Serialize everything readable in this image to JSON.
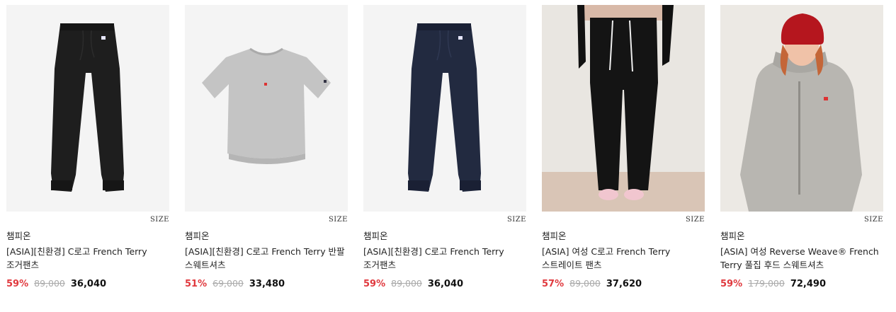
{
  "products": [
    {
      "size_label": "SIZE",
      "brand": "챔피온",
      "name": "[ASIA][친환경] C로고 French Terry 조거팬츠",
      "discount": "59%",
      "original_price": "89,000",
      "price": "36,040",
      "image": "black-jogger-pants"
    },
    {
      "size_label": "SIZE",
      "brand": "챔피온",
      "name": "[ASIA][친환경] C로고 French Terry 반팔 스웨트셔츠",
      "discount": "51%",
      "original_price": "69,000",
      "price": "33,480",
      "image": "gray-short-sleeve-sweatshirt"
    },
    {
      "size_label": "SIZE",
      "brand": "챔피온",
      "name": "[ASIA][친환경] C로고 French Terry 조거팬츠",
      "discount": "59%",
      "original_price": "89,000",
      "price": "36,040",
      "image": "navy-jogger-pants"
    },
    {
      "size_label": "SIZE",
      "brand": "챔피온",
      "name": "[ASIA] 여성 C로고 French Terry 스트레이트 팬츠",
      "discount": "57%",
      "original_price": "89,000",
      "price": "37,620",
      "image": "model-black-straight-pants"
    },
    {
      "size_label": "SIZE",
      "brand": "챔피온",
      "name": "[ASIA] 여성 Reverse Weave® French Terry 풀집 후드 스웨트셔츠",
      "discount": "59%",
      "original_price": "179,000",
      "price": "72,490",
      "image": "model-gray-zip-hoodie"
    }
  ]
}
